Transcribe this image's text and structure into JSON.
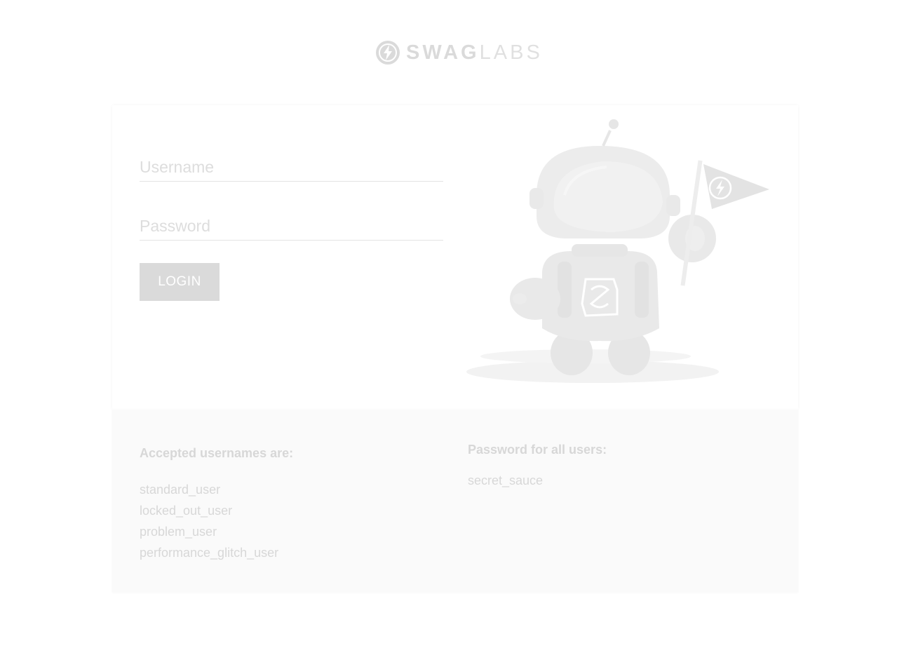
{
  "header": {
    "logo_bold": "SWAG",
    "logo_light": "LABS"
  },
  "login_form": {
    "username_placeholder": "Username",
    "username_value": "",
    "password_placeholder": "Password",
    "password_value": "",
    "login_label": "LOGIN"
  },
  "credentials": {
    "usernames_title": "Accepted usernames are:",
    "usernames": [
      "standard_user",
      "locked_out_user",
      "problem_user",
      "performance_glitch_user"
    ],
    "password_title": "Password for all users:",
    "password": "secret_sauce"
  },
  "icons": {
    "logo": "swag-labs-bolt-logo-icon",
    "bot": "robot-mascot-with-flag-icon"
  },
  "colors": {
    "button": "#3a3a3a",
    "text": "#2a2a2a",
    "panel": "#e6e6e6"
  }
}
